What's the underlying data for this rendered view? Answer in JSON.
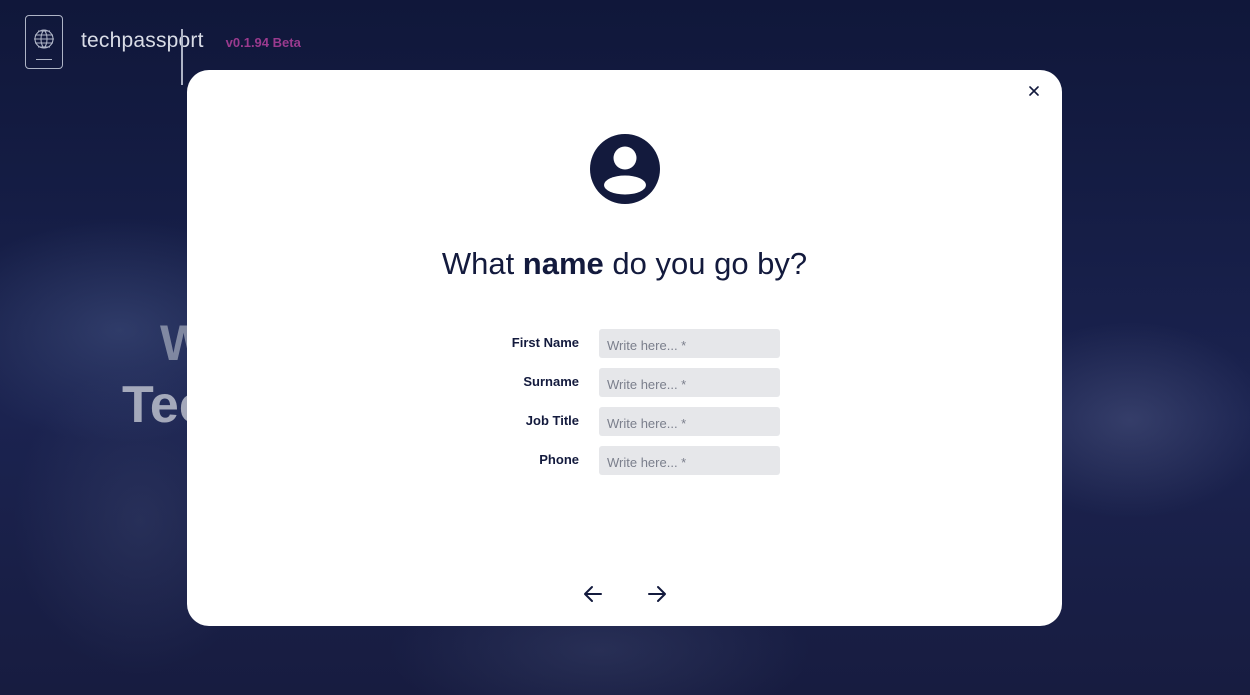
{
  "header": {
    "brand": "techpassport",
    "version": "v0.1.94 Beta",
    "logo_icon": "passport-logo-icon"
  },
  "background": {
    "hero_line1": "W",
    "hero_line2": "Tec"
  },
  "modal": {
    "close_icon": "close-icon",
    "avatar_icon": "user-circle-icon",
    "title_prefix": "What ",
    "title_bold": "name",
    "title_suffix": " do you go by?",
    "fields": [
      {
        "label": "First Name",
        "placeholder": "Write here... *",
        "value": ""
      },
      {
        "label": "Surname",
        "placeholder": "Write here... *",
        "value": ""
      },
      {
        "label": "Job Title",
        "placeholder": "Write here... *",
        "value": ""
      },
      {
        "label": "Phone",
        "placeholder": "Write here... *",
        "value": ""
      }
    ],
    "back_icon": "arrow-left-icon",
    "next_icon": "arrow-right-icon"
  },
  "colors": {
    "navy": "#131a3d",
    "version_accent": "#9a3a8e",
    "input_bg": "#e6e7ea"
  }
}
